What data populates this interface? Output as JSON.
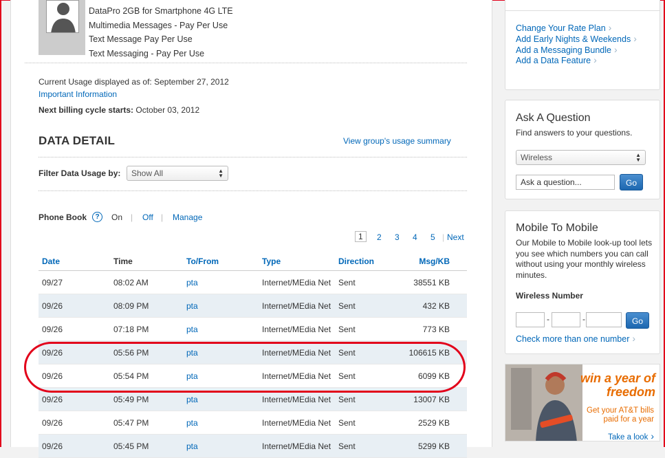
{
  "plan": {
    "features": [
      "DataPro 2GB for Smartphone 4G LTE",
      "Multimedia Messages - Pay Per Use",
      "Text Message Pay Per Use",
      "Text Messaging - Pay Per Use"
    ]
  },
  "usage": {
    "current_label": "Current Usage displayed as of: September 27, 2012",
    "important_link": "Important Information",
    "next_billing_label": "Next billing cycle starts:",
    "next_billing_value": " October 03, 2012"
  },
  "data_detail": {
    "title": "DATA DETAIL",
    "group_link": "View group's usage summary",
    "filter_label": "Filter Data Usage by:",
    "filter_value": "Show All"
  },
  "phone_book": {
    "label": "Phone Book",
    "help": "?",
    "on": "On",
    "off": "Off",
    "manage": "Manage",
    "sep": "|"
  },
  "pager": {
    "pages": [
      "1",
      "2",
      "3",
      "4",
      "5"
    ],
    "next": "Next",
    "current": 1
  },
  "table": {
    "headers": [
      "Date",
      "Time",
      "To/From",
      "Type",
      "Direction",
      "Msg/KB"
    ],
    "rows": [
      [
        "09/27",
        "08:02 AM",
        "pta",
        "Internet/MEdia Net",
        "Sent",
        "38551 KB"
      ],
      [
        "09/26",
        "08:09 PM",
        "pta",
        "Internet/MEdia Net",
        "Sent",
        "432 KB"
      ],
      [
        "09/26",
        "07:18 PM",
        "pta",
        "Internet/MEdia Net",
        "Sent",
        "773 KB"
      ],
      [
        "09/26",
        "05:56 PM",
        "pta",
        "Internet/MEdia Net",
        "Sent",
        "106615 KB"
      ],
      [
        "09/26",
        "05:54 PM",
        "pta",
        "Internet/MEdia Net",
        "Sent",
        "6099 KB"
      ],
      [
        "09/26",
        "05:49 PM",
        "pta",
        "Internet/MEdia Net",
        "Sent",
        "13007 KB"
      ],
      [
        "09/26",
        "05:47 PM",
        "pta",
        "Internet/MEdia Net",
        "Sent",
        "2529 KB"
      ],
      [
        "09/26",
        "05:45 PM",
        "pta",
        "Internet/MEdia Net",
        "Sent",
        "5299 KB"
      ]
    ]
  },
  "sidebar": {
    "plan_links": [
      "Change Your Rate Plan",
      "Add Early Nights & Weekends",
      "Add a Messaging Bundle",
      "Add a Data Feature"
    ],
    "ask": {
      "title": "Ask A Question",
      "desc": "Find answers to your questions.",
      "select_value": "Wireless",
      "input_placeholder": "Ask a question...",
      "go": "Go"
    },
    "m2m": {
      "title": "Mobile To Mobile",
      "desc": "Our Mobile to Mobile look-up tool lets you see which numbers you can call without using your monthly wireless minutes.",
      "number_label": "Wireless Number",
      "dash": "-",
      "go": "Go",
      "more_link": "Check more than one number"
    },
    "promo": {
      "title": "win a year of freedom",
      "sub": "Get your AT&T bills paid for a year",
      "link": "Take a look"
    }
  },
  "colors": {
    "link": "#0067b8",
    "highlight": "#e2001a",
    "promo": "#e86c00",
    "row_alt": "#e8eff4"
  }
}
